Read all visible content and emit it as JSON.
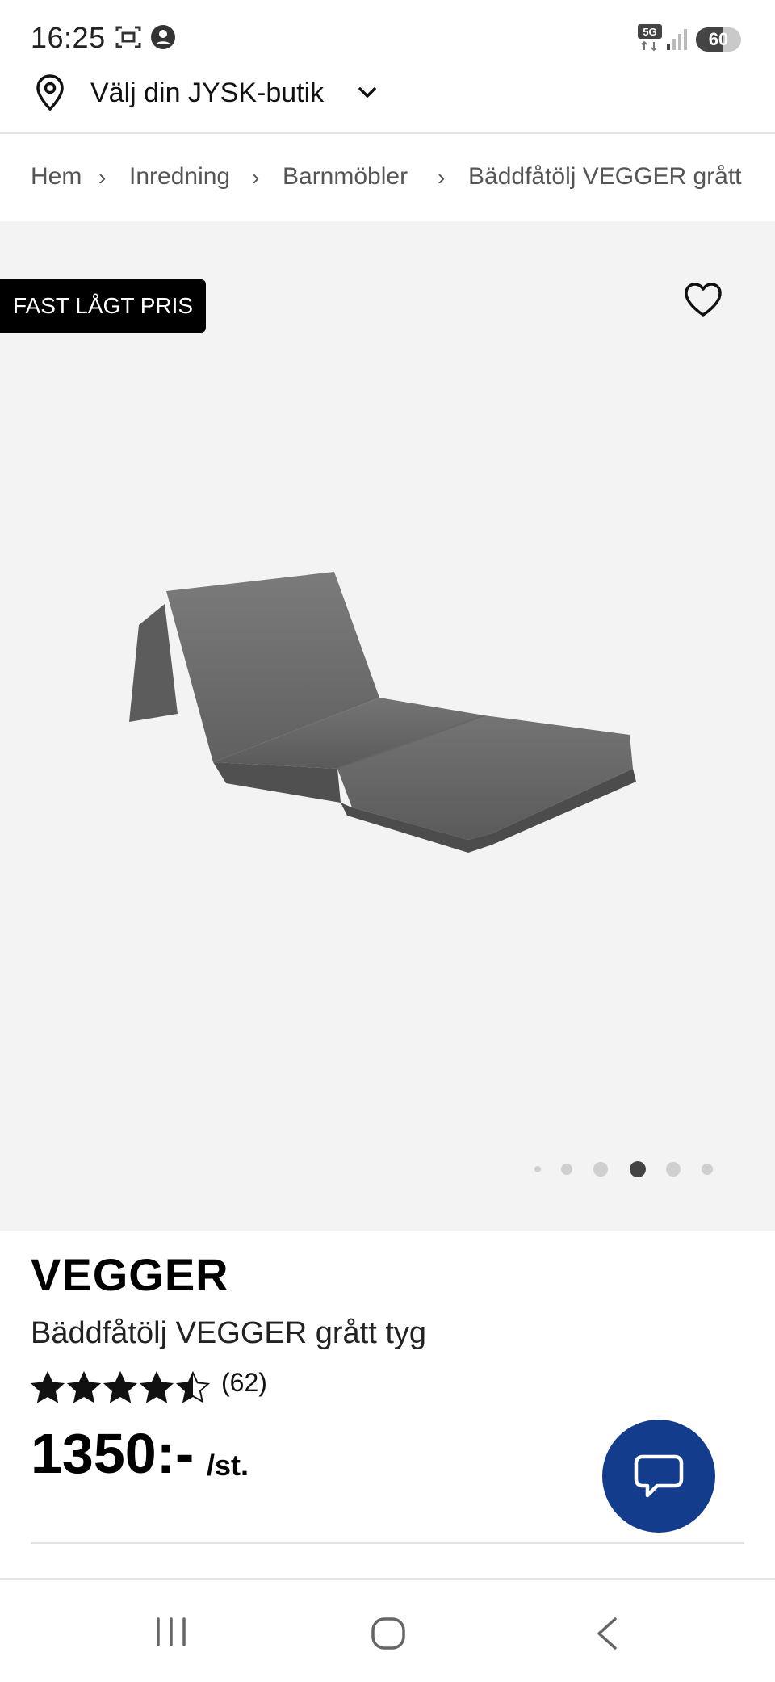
{
  "status_bar": {
    "time": "16:25",
    "network": "5G",
    "battery_level": 60,
    "battery_text": "60",
    "icons": [
      "screenshot-icon",
      "account-circle-icon",
      "network-5g-icon",
      "signal-icon",
      "battery-icon"
    ]
  },
  "store_selector": {
    "label": "Välj din JYSK-butik",
    "icon": "location-pin-icon"
  },
  "breadcrumb": [
    "Hem",
    "Inredning",
    "Barnmöbler",
    "Bäddfåtölj VEGGER grått"
  ],
  "gallery": {
    "badge": "FAST LÅGT PRIS",
    "favorite_icon": "heart-outline-icon",
    "image_count": 6,
    "active_index": 3
  },
  "product": {
    "brand": "VEGGER",
    "title": "Bäddfåtölj VEGGER grått tyg",
    "rating": 4.5,
    "rating_max": 5,
    "review_count": "(62)",
    "price": "1350:-",
    "unit": "/st."
  },
  "chat": {
    "icon": "chat-bubble-icon"
  },
  "colors": {
    "brand_blue": "#143c8c",
    "badge_bg": "#000000",
    "gallery_bg": "#f3f3f3"
  },
  "navigation": {
    "icons": [
      "recent-apps-icon",
      "home-icon",
      "back-icon"
    ]
  }
}
